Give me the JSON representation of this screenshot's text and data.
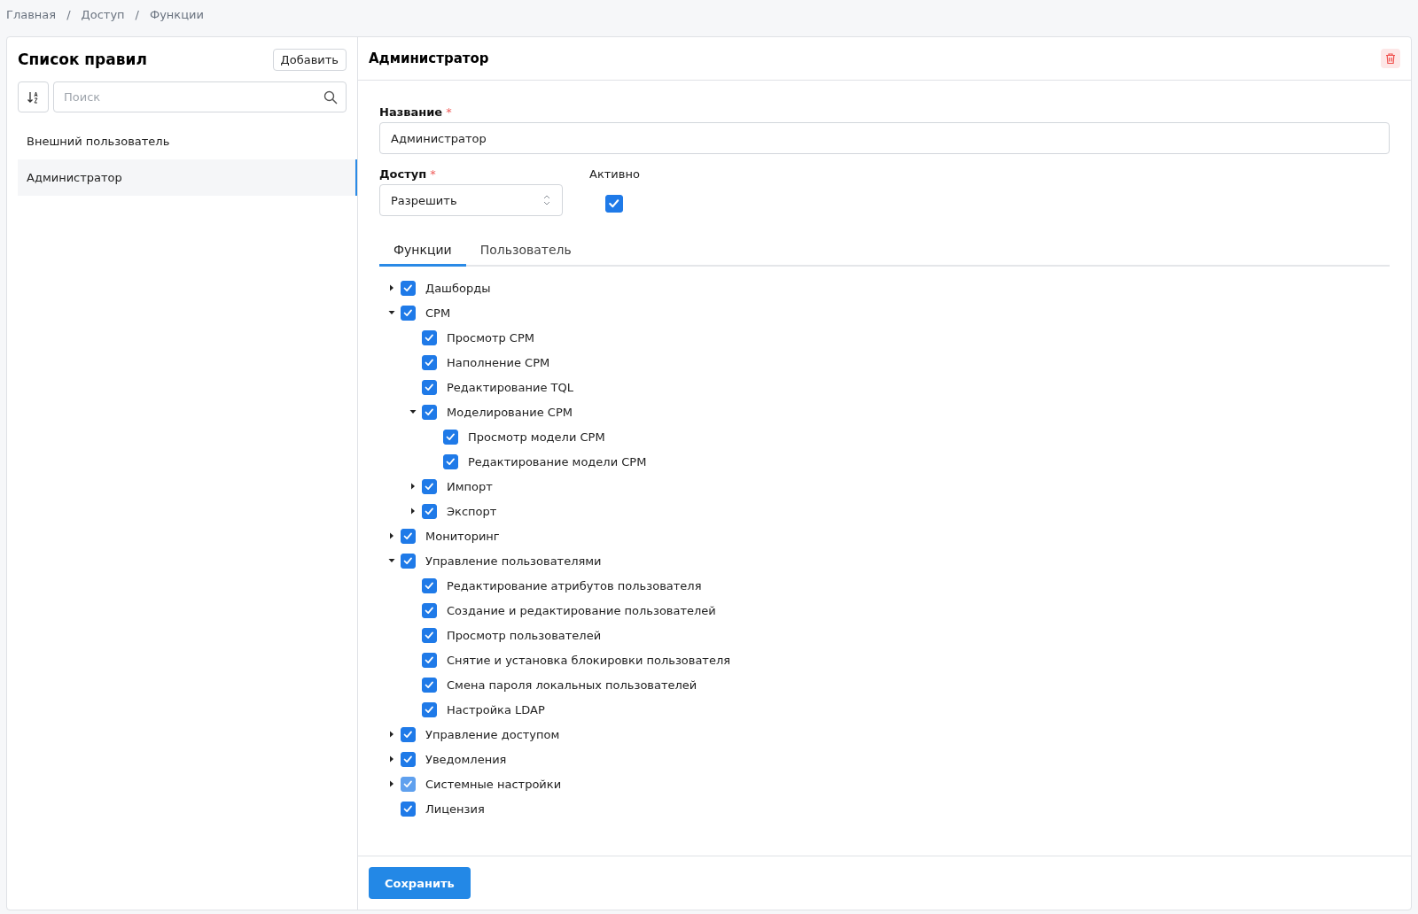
{
  "breadcrumbs": [
    "Главная",
    "Доступ",
    "Функции"
  ],
  "breadcrumb_separators": [
    "/",
    "/"
  ],
  "rules_panel": {
    "title": "Список правил",
    "add_button": "Добавить",
    "search": {
      "placeholder": "Поиск"
    },
    "items": [
      {
        "label": "Внешний пользователь",
        "selected": false
      },
      {
        "label": "Администратор",
        "selected": true
      }
    ]
  },
  "editor": {
    "title": "Администратор",
    "name_field": {
      "label": "Название",
      "required_mark": "*",
      "value": "Администратор"
    },
    "access_field": {
      "label": "Доступ",
      "required_mark": "*",
      "value": "Разрешить"
    },
    "active": {
      "label": "Активно",
      "checked": true
    },
    "tabs": [
      {
        "label": "Функции",
        "selected": true
      },
      {
        "label": "Пользователь",
        "selected": false
      }
    ],
    "tree": [
      {
        "label": "Дашборды",
        "checked": true,
        "disabled": false,
        "expanded": false
      },
      {
        "label": "СРМ",
        "checked": true,
        "disabled": false,
        "expanded": true,
        "children": [
          {
            "label": "Просмотр СРМ",
            "checked": true,
            "disabled": false
          },
          {
            "label": "Наполнение СРМ",
            "checked": true,
            "disabled": false
          },
          {
            "label": "Редактирование TQL",
            "checked": true,
            "disabled": false
          },
          {
            "label": "Моделирование СРМ",
            "checked": true,
            "disabled": false,
            "expanded": true,
            "children": [
              {
                "label": "Просмотр модели СРМ",
                "checked": true,
                "disabled": false
              },
              {
                "label": "Редактирование модели СРМ",
                "checked": true,
                "disabled": false
              }
            ]
          },
          {
            "label": "Импорт",
            "checked": true,
            "disabled": false,
            "expanded": false
          },
          {
            "label": "Экспорт",
            "checked": true,
            "disabled": false,
            "expanded": false
          }
        ]
      },
      {
        "label": "Мониторинг",
        "checked": true,
        "disabled": false,
        "expanded": false
      },
      {
        "label": "Управление пользователями",
        "checked": true,
        "disabled": false,
        "expanded": true,
        "children": [
          {
            "label": "Редактирование атрибутов пользователя",
            "checked": true,
            "disabled": false
          },
          {
            "label": "Создание и редактирование пользователей",
            "checked": true,
            "disabled": false
          },
          {
            "label": "Просмотр пользователей",
            "checked": true,
            "disabled": false
          },
          {
            "label": "Снятие и установка блокировки пользователя",
            "checked": true,
            "disabled": false
          },
          {
            "label": "Смена пароля локальных пользователей",
            "checked": true,
            "disabled": false
          },
          {
            "label": "Настройка LDAP",
            "checked": true,
            "disabled": false
          }
        ]
      },
      {
        "label": "Управление доступом",
        "checked": true,
        "disabled": false,
        "expanded": false
      },
      {
        "label": "Уведомления",
        "checked": true,
        "disabled": false,
        "expanded": false
      },
      {
        "label": "Системные настройки",
        "checked": true,
        "disabled": true,
        "expanded": false
      },
      {
        "label": "Лицензия",
        "checked": true,
        "disabled": false
      }
    ],
    "save_button": "Сохранить"
  }
}
